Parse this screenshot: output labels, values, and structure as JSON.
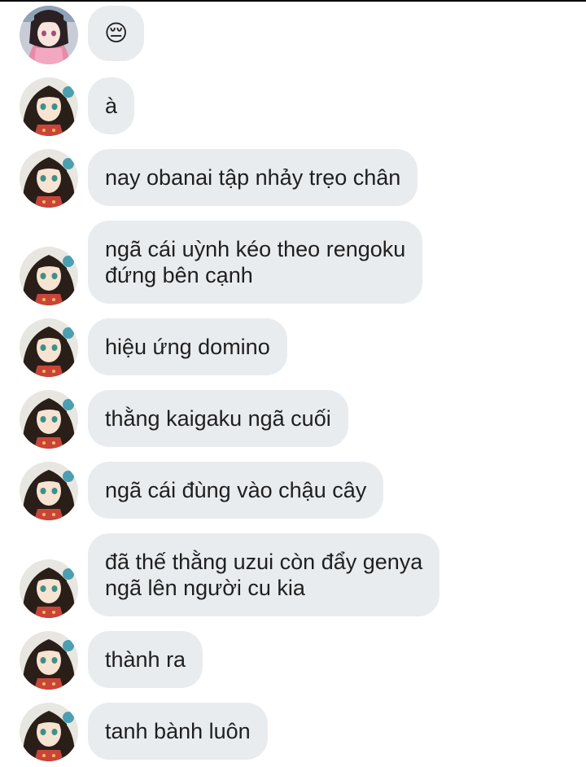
{
  "chat": {
    "messages": [
      {
        "sender": "nezuko",
        "text": "😔"
      },
      {
        "sender": "mitsuri",
        "text": "à"
      },
      {
        "sender": "mitsuri",
        "text": "nay obanai tập nhảy trẹo chân"
      },
      {
        "sender": "mitsuri",
        "lines": [
          "ngã cái uỳnh kéo theo rengoku",
          "đứng bên cạnh"
        ]
      },
      {
        "sender": "mitsuri",
        "text": "hiệu ứng domino"
      },
      {
        "sender": "mitsuri",
        "text": "thằng kaigaku ngã cuối"
      },
      {
        "sender": "mitsuri",
        "text": "ngã cái đùng vào chậu cây"
      },
      {
        "sender": "mitsuri",
        "lines": [
          "đã thế thằng uzui còn đẩy genya",
          "ngã lên người cu kia"
        ]
      },
      {
        "sender": "mitsuri",
        "text": "thành ra"
      },
      {
        "sender": "mitsuri",
        "text": "tanh bành luôn"
      }
    ]
  },
  "colors": {
    "bubble_bg": "#e9ecef",
    "text": "#1f1f1f",
    "background": "#ffffff"
  }
}
